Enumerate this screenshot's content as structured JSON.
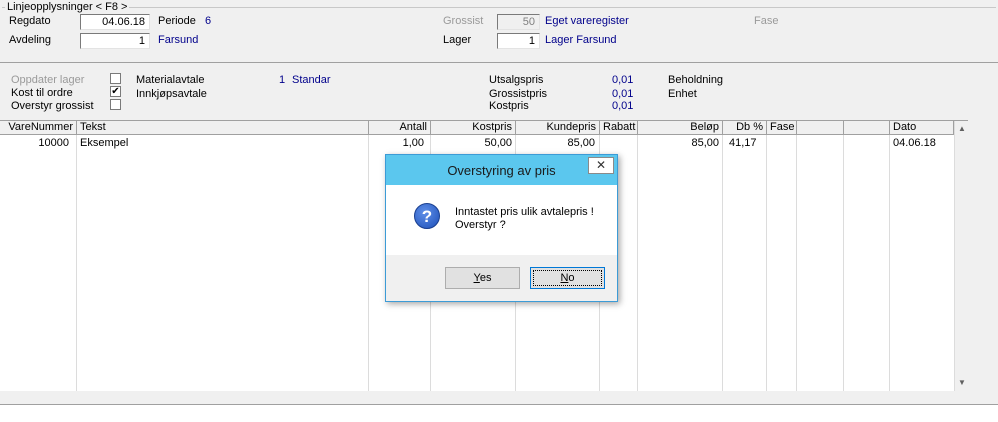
{
  "header": {
    "group_title": "Linjeopplysninger < F8 >",
    "regdato_label": "Regdato",
    "regdato_value": "04.06.18",
    "periode_label": "Periode",
    "periode_value": "6",
    "avdeling_label": "Avdeling",
    "avdeling_value": "1",
    "avdeling_name": "Farsund",
    "grossist_label": "Grossist",
    "grossist_value": "50",
    "grossist_name": "Eget vareregister",
    "fase_label": "Fase",
    "lager_label": "Lager",
    "lager_value": "1",
    "lager_name": "Lager Farsund"
  },
  "options": {
    "oppdater_lager": "Oppdater lager",
    "kost_til_ordre": "Kost til ordre",
    "overstyr_grossist": "Overstyr grossist",
    "materialavtale_label": "Materialavtale",
    "materialavtale_value": "1",
    "materialavtale_name": "Standar",
    "innkjopsavtale_label": "Innkjøpsavtale",
    "check_mark": "✔",
    "utsalgspris_label": "Utsalgspris",
    "utsalgspris_value": "0,01",
    "grossistpris_label": "Grossistpris",
    "grossistpris_value": "0,01",
    "kostpris_label": "Kostpris",
    "kostpris_value": "0,01",
    "beholdning_label": "Beholdning",
    "enhet_label": "Enhet"
  },
  "table": {
    "columns": [
      "VareNummer",
      "Tekst",
      "Antall",
      "Kostpris",
      "Kundepris",
      "Rabatt",
      "Beløp",
      "Db %",
      "Fase",
      "",
      "",
      "Dato"
    ],
    "rows": [
      [
        "10000",
        "Eksempel",
        "1,00",
        "50,00",
        "85,00",
        "",
        "85,00",
        "41,17",
        "",
        "",
        "",
        "04.06.18"
      ]
    ]
  },
  "dialog": {
    "title": "Overstyring av pris",
    "close": "✕",
    "icon": "question-icon",
    "line1": "Inntastet pris ulik avtalepris !",
    "line2": "Overstyr ?",
    "yes_rest": "es",
    "yes_key": "Y",
    "no_rest": "o",
    "no_key": "N"
  }
}
